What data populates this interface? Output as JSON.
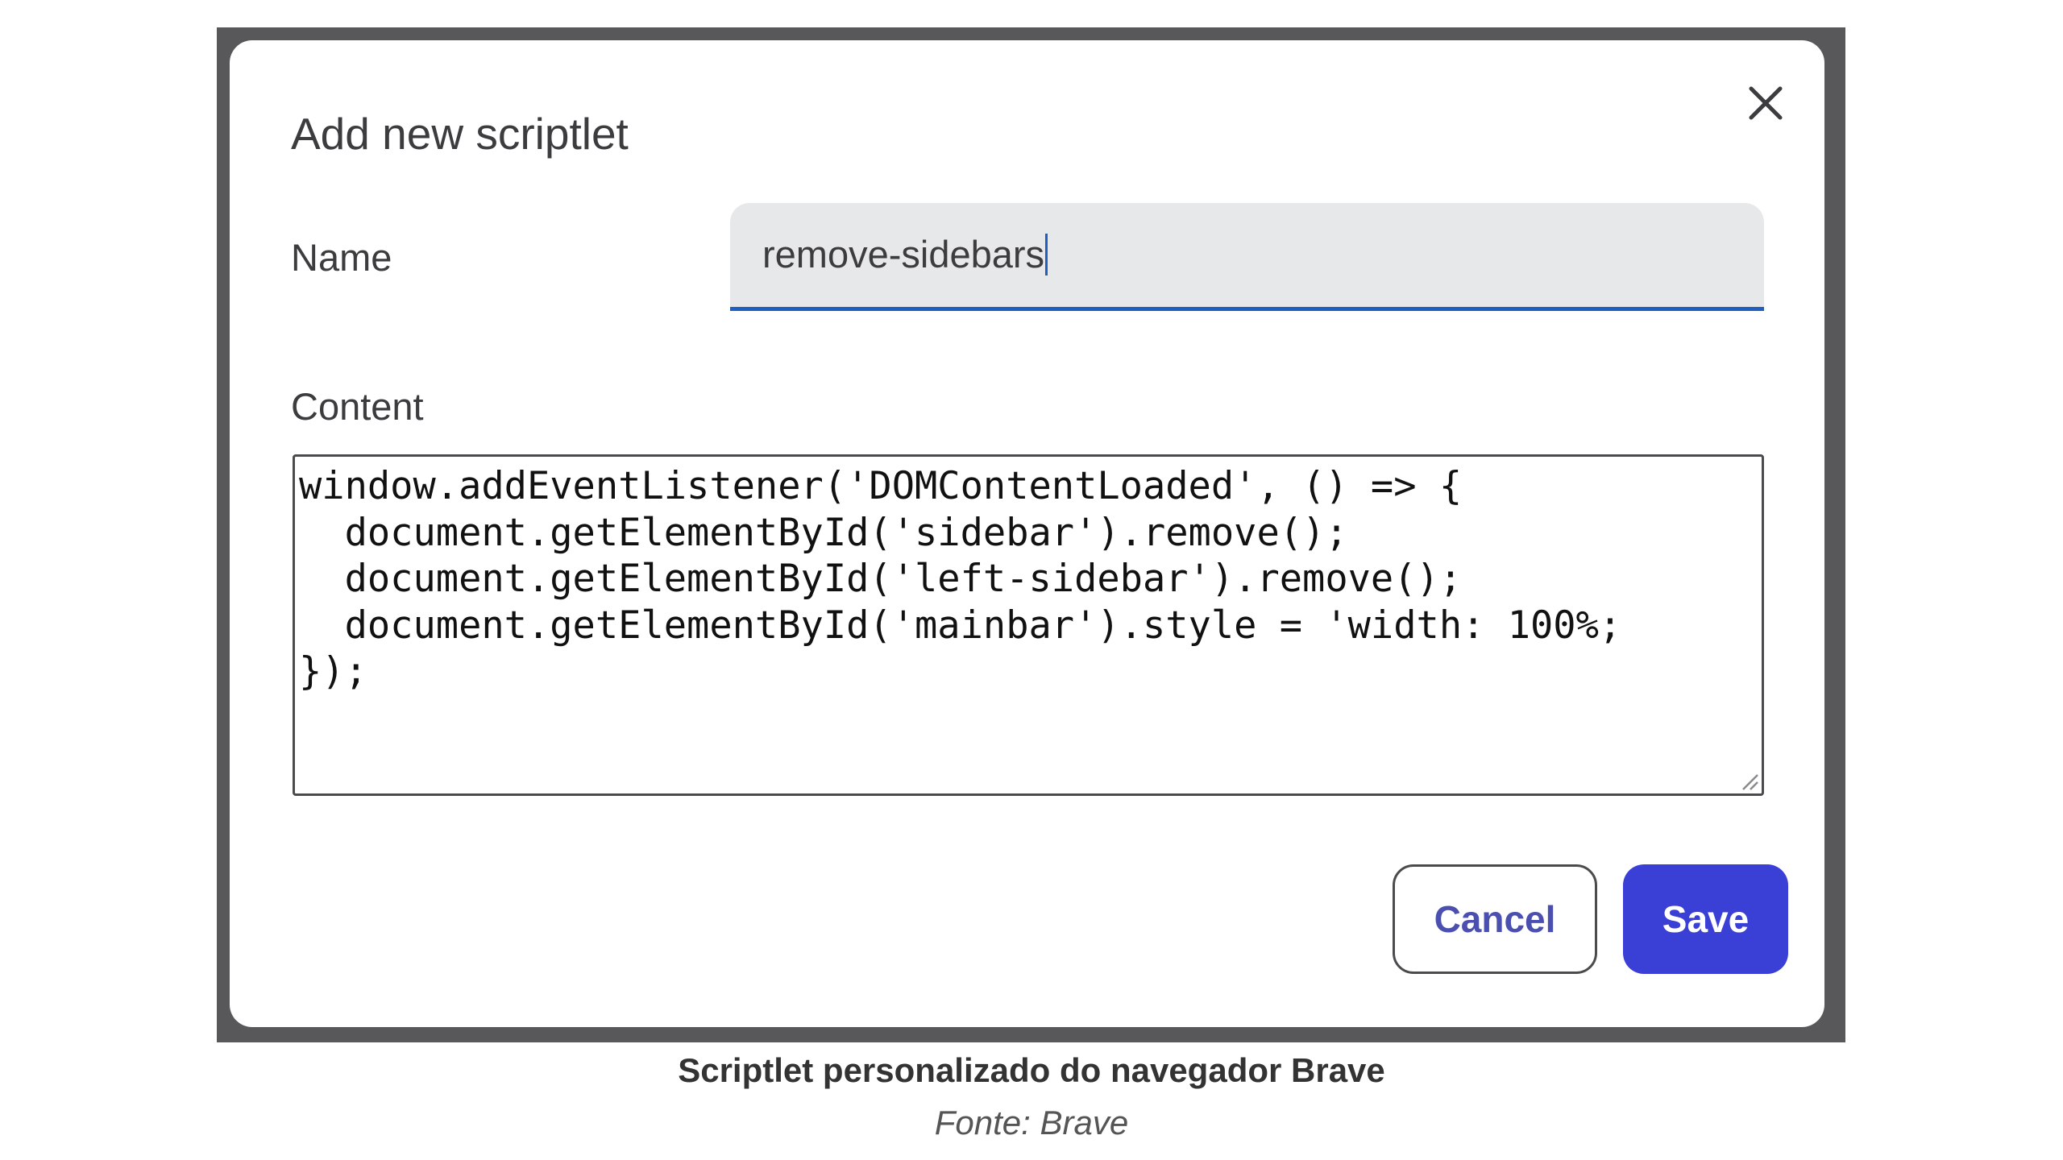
{
  "dialog": {
    "title": "Add new scriptlet",
    "close_icon": "close-icon",
    "name_label": "Name",
    "name_value": "remove-sidebars",
    "content_label": "Content",
    "content_lines": [
      "window.addEventListener('DOMContentLoaded', () => {",
      "  document.getElementById('sidebar').remove();",
      "  document.getElementById('left-sidebar').remove();",
      "  document.getElementById('mainbar').style = 'width: 100%;",
      "});"
    ],
    "cancel_label": "Cancel",
    "save_label": "Save"
  },
  "caption": {
    "title": "Scriptlet personalizado do navegador Brave",
    "source": "Fonte: Brave"
  },
  "colors": {
    "accent": "#3a3fd6",
    "focus_underline": "#1f5fbf",
    "frame": "#58585a"
  }
}
